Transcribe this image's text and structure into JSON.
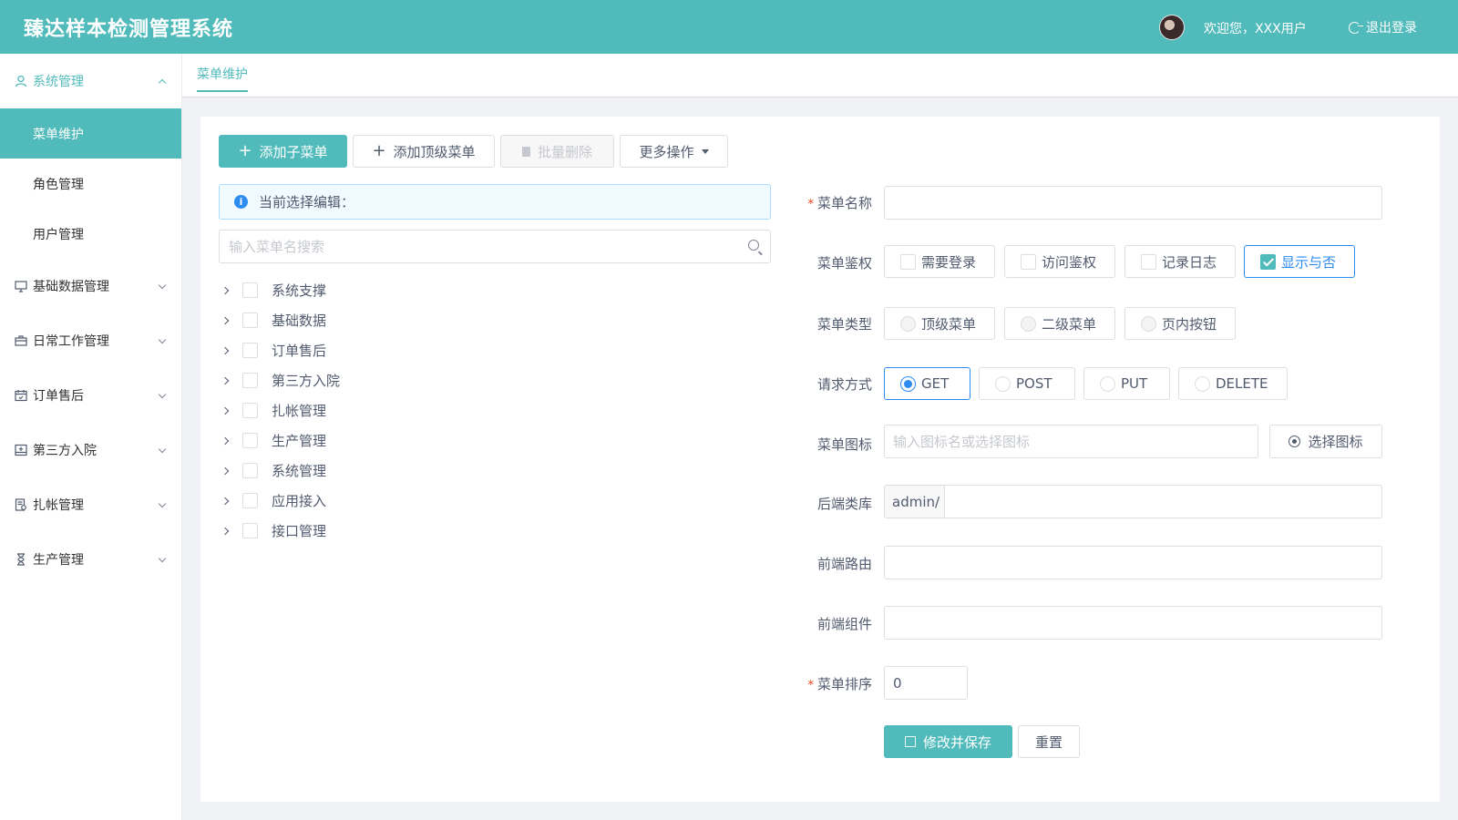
{
  "header": {
    "app_title": "臻达样本检测管理系统",
    "welcome": "欢迎您，XXX用户",
    "logout": "退出登录"
  },
  "sidebar": {
    "groups": [
      {
        "label": "系统管理",
        "icon": "user-icon",
        "expanded": true,
        "items": [
          {
            "label": "菜单维护",
            "active": true
          },
          {
            "label": "角色管理"
          },
          {
            "label": "用户管理"
          }
        ]
      },
      {
        "label": "基础数据管理",
        "icon": "monitor-icon"
      },
      {
        "label": "日常工作管理",
        "icon": "briefcase-icon"
      },
      {
        "label": "订单售后",
        "icon": "calendar-icon"
      },
      {
        "label": "第三方入院",
        "icon": "hospital-icon"
      },
      {
        "label": "扎帐管理",
        "icon": "ledger-icon"
      },
      {
        "label": "生产管理",
        "icon": "hourglass-icon"
      }
    ]
  },
  "tabs": {
    "active": "菜单维护"
  },
  "toolbar": {
    "add_child": "添加子菜单",
    "add_top": "添加顶级菜单",
    "batch_delete": "批量删除",
    "more": "更多操作"
  },
  "info": {
    "current_edit": "当前选择编辑："
  },
  "search": {
    "placeholder": "输入菜单名搜索"
  },
  "tree": [
    "系统支撑",
    "基础数据",
    "订单售后",
    "第三方入院",
    "扎帐管理",
    "生产管理",
    "系统管理",
    "应用接入",
    "接口管理"
  ],
  "form": {
    "menu_name": {
      "label": "菜单名称",
      "value": ""
    },
    "auth": {
      "label": "菜单鉴权",
      "options": [
        {
          "label": "需要登录",
          "checked": false
        },
        {
          "label": "访问鉴权",
          "checked": false
        },
        {
          "label": "记录日志",
          "checked": false
        },
        {
          "label": "显示与否",
          "checked": true
        }
      ]
    },
    "menu_type": {
      "label": "菜单类型",
      "options": [
        "顶级菜单",
        "二级菜单",
        "页内按钮"
      ]
    },
    "method": {
      "label": "请求方式",
      "options": [
        "GET",
        "POST",
        "PUT",
        "DELETE"
      ],
      "selected": "GET"
    },
    "icon": {
      "label": "菜单图标",
      "placeholder": "输入图标名或选择图标",
      "select_button": "选择图标"
    },
    "backend": {
      "label": "后端类库",
      "prefix": "admin/",
      "value": ""
    },
    "frontend_route": {
      "label": "前端路由",
      "value": ""
    },
    "frontend_component": {
      "label": "前端组件",
      "value": ""
    },
    "sort": {
      "label": "菜单排序",
      "value": "0"
    },
    "save": "修改并保存",
    "reset": "重置"
  },
  "colors": {
    "primary": "#51babb",
    "info": "#2d8cf0",
    "required": "#ed4014"
  }
}
